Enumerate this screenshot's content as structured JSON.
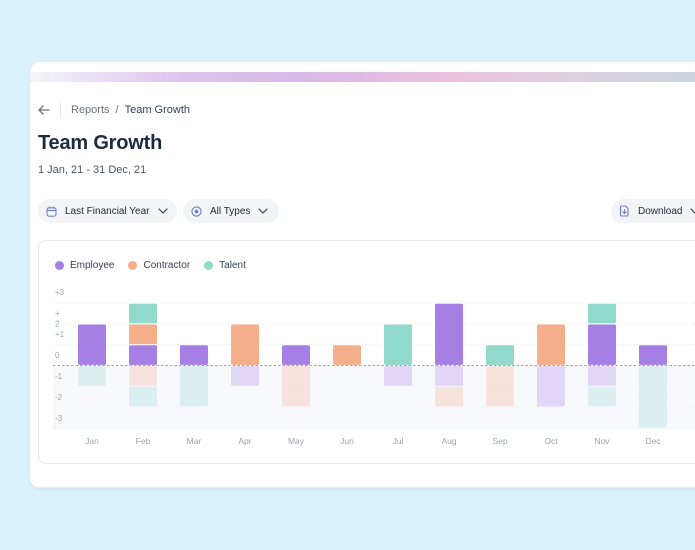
{
  "breadcrumb": {
    "parent": "Reports",
    "separator": "/",
    "current": "Team Growth"
  },
  "page": {
    "title": "Team Growth",
    "date_range": "1 Jan, 21 - 31 Dec, 21"
  },
  "filters": {
    "period_label": "Last Financial Year",
    "type_label": "All Types",
    "download_label": "Download"
  },
  "icons": {
    "back": "arrow-left-icon",
    "calendar": "calendar-icon",
    "type": "target-icon",
    "chevron": "chevron-down-icon",
    "download": "file-download-icon"
  },
  "colors": {
    "background": "#daf2fd",
    "employee": "#a57fe3",
    "contractor": "#f5ae8a",
    "talent": "#91d9cb",
    "title": "#1e2a44"
  },
  "chart_data": {
    "type": "bar",
    "stacked": true,
    "categories": [
      "Jan",
      "Feb",
      "Mar",
      "Apr",
      "May",
      "Jun",
      "Jul",
      "Aug",
      "Sep",
      "Oct",
      "Nov",
      "Dec"
    ],
    "series": [
      {
        "name": "Employee",
        "positive": [
          2,
          1,
          1,
          0,
          1,
          0,
          0,
          3,
          0,
          0,
          2,
          1
        ],
        "negative": [
          0,
          0,
          0,
          -1,
          0,
          0,
          -1,
          -1,
          0,
          -2,
          -1,
          0
        ]
      },
      {
        "name": "Contractor",
        "positive": [
          0,
          1,
          0,
          2,
          0,
          1,
          0,
          0,
          0,
          2,
          0,
          0
        ],
        "negative": [
          0,
          -1,
          0,
          0,
          -2,
          0,
          0,
          -1,
          -2,
          0,
          0,
          0
        ]
      },
      {
        "name": "Talent",
        "positive": [
          0,
          1,
          0,
          0,
          0,
          0,
          2,
          0,
          1,
          0,
          1,
          0
        ],
        "negative": [
          -1,
          -1,
          -2,
          0,
          0,
          0,
          0,
          0,
          0,
          0,
          -1,
          -3
        ]
      }
    ],
    "yticks": [
      "+3",
      "+",
      "2",
      "+1",
      "0",
      "-1",
      "-2",
      "-3"
    ],
    "ylim": [
      -3,
      3
    ],
    "legend": "top-left",
    "grid": true
  }
}
